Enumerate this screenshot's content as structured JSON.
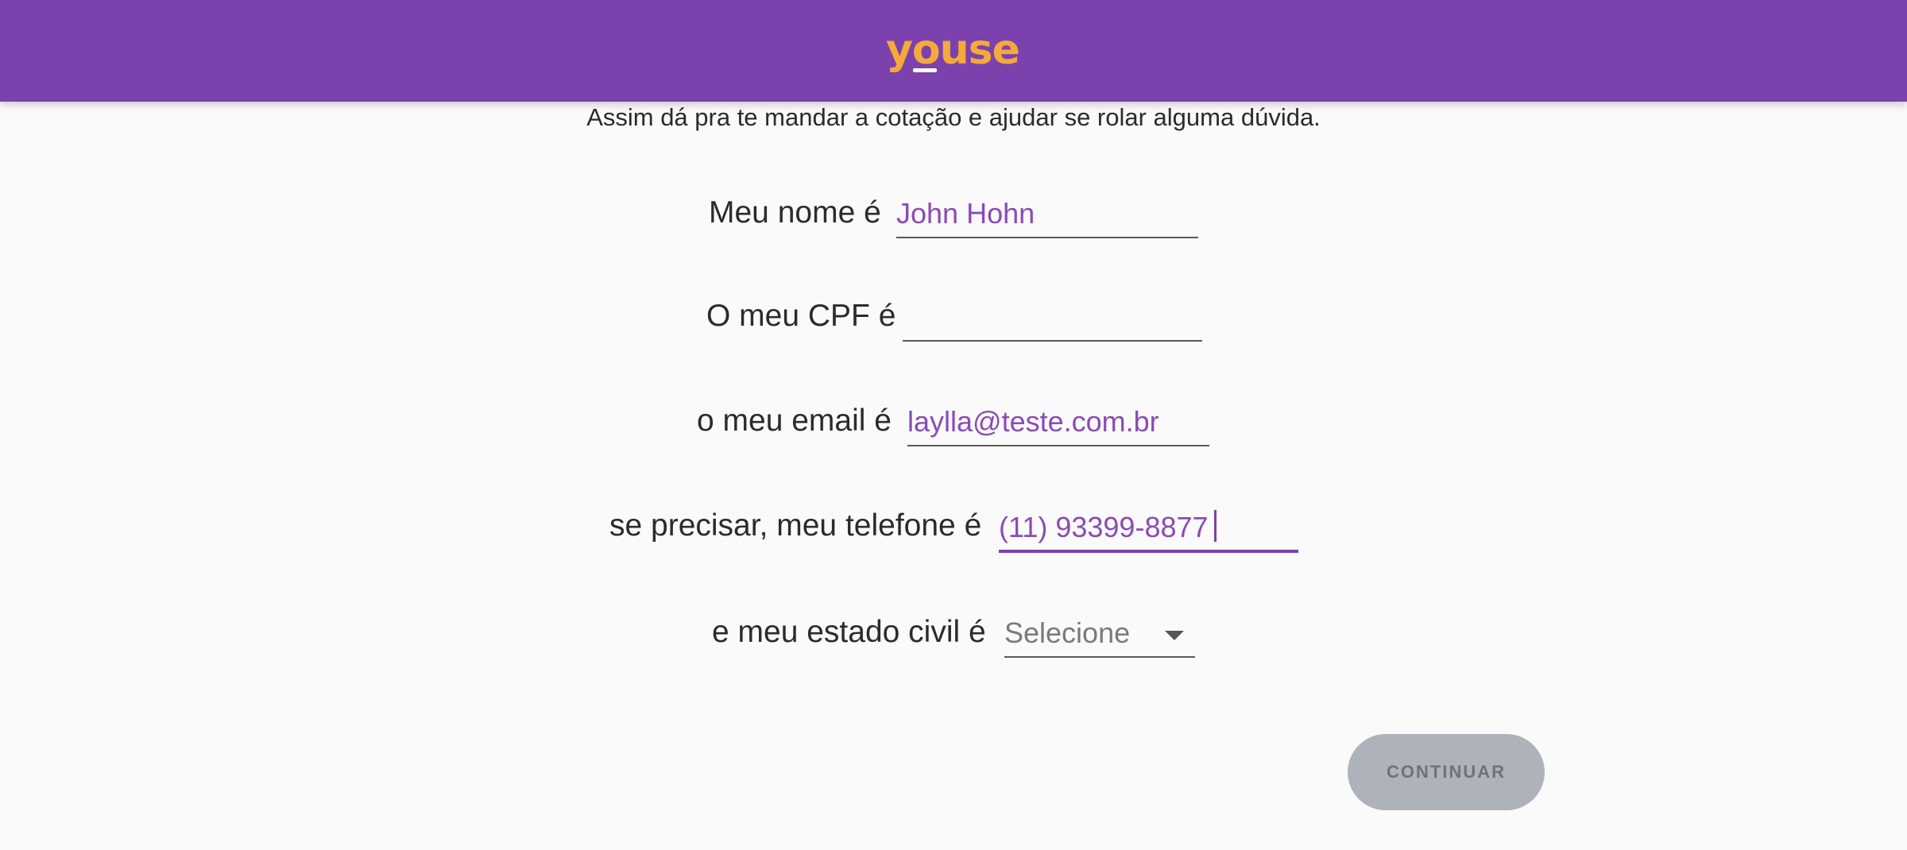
{
  "header": {
    "logo_text": "youse",
    "background_color": "#7b42ae",
    "logo_color": "#f6a93b"
  },
  "form": {
    "subtitle": "Assim dá pra te mandar a cotação e ajudar se rolar alguma dúvida.",
    "name": {
      "label": "Meu nome é",
      "value": "John Hohn"
    },
    "cpf": {
      "label": "O meu CPF é",
      "value": ""
    },
    "email": {
      "label": "o meu email é",
      "value": "laylla@teste.com.br"
    },
    "phone": {
      "label": "se precisar, meu telefone é",
      "value": "(11) 93399-8877"
    },
    "marital_status": {
      "label": "e meu estado civil é",
      "selected": "Selecione"
    },
    "continue_label": "CONTINUAR"
  },
  "colors": {
    "accent": "#7b42ae",
    "input_text": "#8a4bb8",
    "button_disabled": "#aeb2ba"
  }
}
